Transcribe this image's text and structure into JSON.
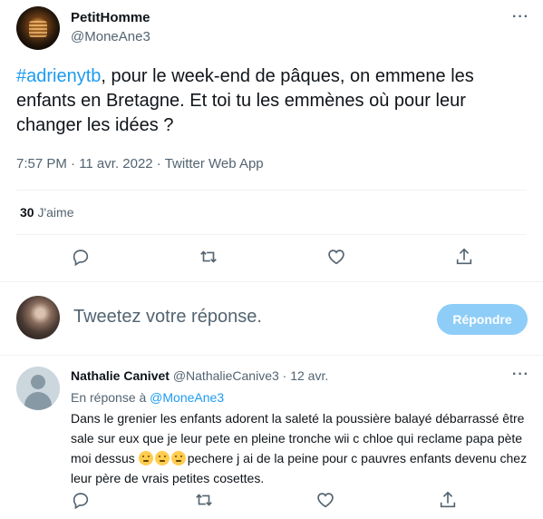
{
  "tweet": {
    "author_name": "PetitHomme",
    "author_handle": "@MoneAne3",
    "more_icon": "more-horizontal-icon",
    "hashtag": "#adrienytb",
    "text_rest": ", pour le week-end de pâques, on emmene les enfants en Bretagne. Et toi tu les emmènes où pour leur changer les idées ?",
    "meta": "7:57 PM · 11 avr. 2022 · Twitter Web App",
    "likes_count": "30",
    "likes_label": " J'aime"
  },
  "actions": [
    "reply-icon",
    "retweet-icon",
    "like-icon",
    "share-icon"
  ],
  "compose": {
    "placeholder": "Tweetez votre réponse.",
    "button_label": "Répondre",
    "button_color": "#8ecdf8"
  },
  "reply": {
    "author_name": "Nathalie Canivet",
    "author_handle": "@NathalieCanive3",
    "date": "· 12 avr.",
    "replying_to_prefix": "En réponse à ",
    "replying_to": "@MoneAne3",
    "text_before_emoji": "Dans le grenier les enfants adorent la saleté la poussière balayé débarrassé être sale sur eux que je leur pete en pleine tronche wii c chloe qui reclame papa pète moi dessus ",
    "text_after_emoji": "pechere j ai de la peine pour c pauvres enfants devenu chez leur père de vrais petites  cosettes.",
    "emojis": [
      "thinking-face-icon",
      "confused-face-icon",
      "confused-face-icon"
    ]
  },
  "colors": {
    "accent": "#1d9bf0",
    "secondary_text": "#536471",
    "divider": "#eff3f4"
  }
}
